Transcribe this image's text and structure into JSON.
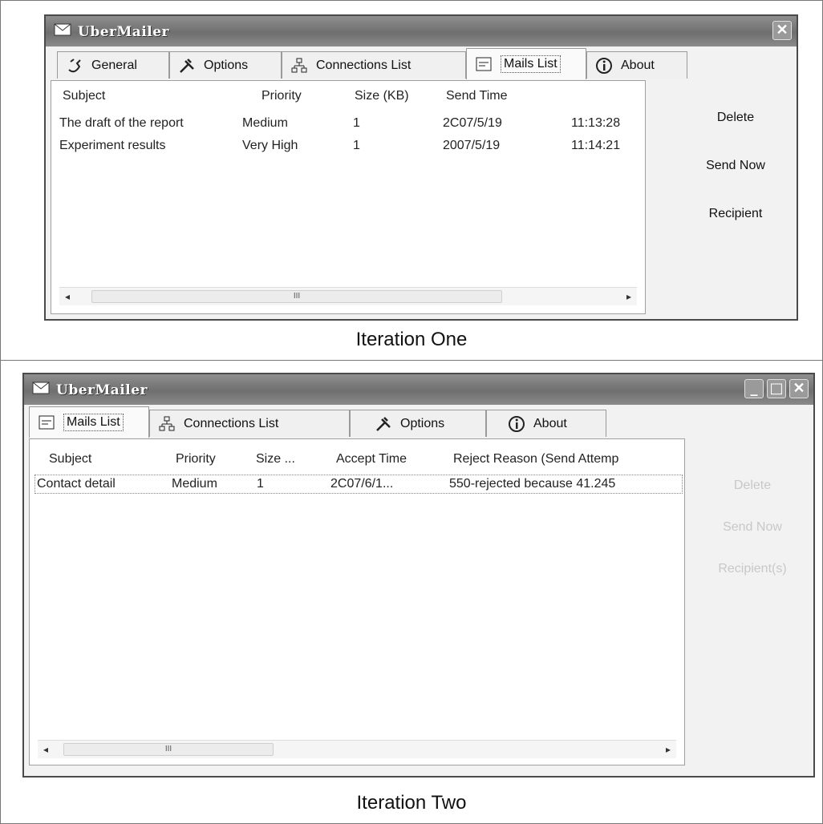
{
  "iteration_one": {
    "caption": "Iteration One",
    "window": {
      "title": "UberMailer",
      "tabs": [
        {
          "label": "General",
          "icon": "general-icon"
        },
        {
          "label": "Options",
          "icon": "tools-icon"
        },
        {
          "label": "Connections List",
          "icon": "network-icon"
        },
        {
          "label": "Mails List",
          "icon": "list-icon",
          "selected": true
        },
        {
          "label": "About",
          "icon": "info-icon"
        }
      ],
      "columns": [
        "Subject",
        "Priority",
        "Size (KB)",
        "Send Time"
      ],
      "rows": [
        {
          "subject": "The draft of the report",
          "priority": "Medium",
          "size": "1",
          "date": "2C07/5/19",
          "time": "11:13:28"
        },
        {
          "subject": "Experiment results",
          "priority": "Very High",
          "size": "1",
          "date": "2007/5/19",
          "time": "11:14:21"
        }
      ],
      "buttons": {
        "delete": "Delete",
        "send_now": "Send Now",
        "recipient": "Recipient"
      },
      "scroll_thumb": "III"
    }
  },
  "iteration_two": {
    "caption": "Iteration Two",
    "window": {
      "title": "UberMailer",
      "tabs": [
        {
          "label": "Mails List",
          "icon": "list-icon",
          "selected": true
        },
        {
          "label": "Connections List",
          "icon": "network-icon"
        },
        {
          "label": "Options",
          "icon": "tools-icon"
        },
        {
          "label": "About",
          "icon": "info-icon"
        }
      ],
      "columns": [
        "Subject",
        "Priority",
        "Size ...",
        "Accept Time",
        "Reject Reason (Send Attemp"
      ],
      "rows": [
        {
          "subject": "Contact detail",
          "priority": "Medium",
          "size": "1",
          "accept_time": "2C07/6/1...",
          "reason": "550-rejected because 41.245"
        }
      ],
      "buttons": {
        "delete": "Delete",
        "send_now": "Send Now",
        "recipient": "Recipient(s)"
      },
      "scroll_thumb": "III"
    }
  }
}
